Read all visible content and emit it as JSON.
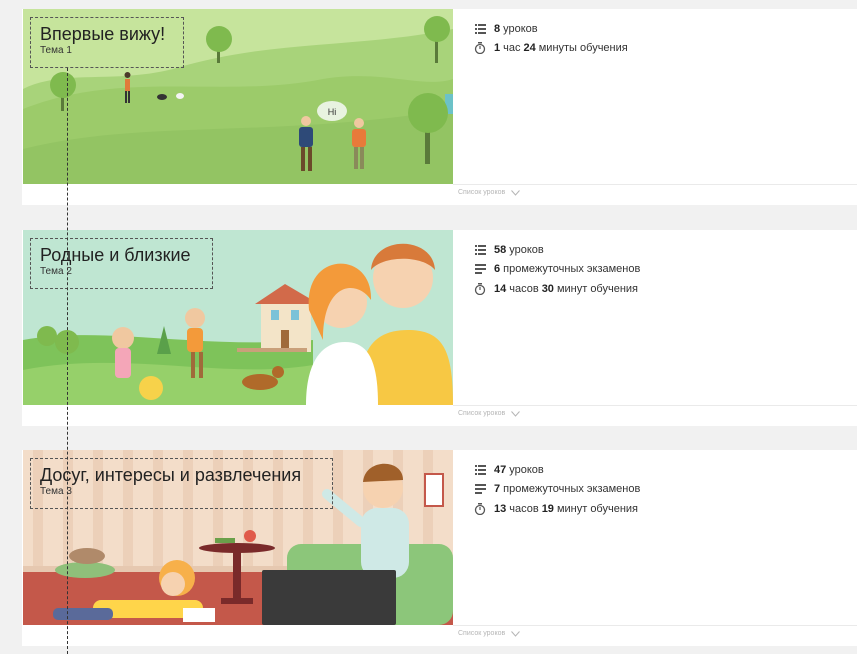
{
  "topics": [
    {
      "title": "Впервые вижу!",
      "subtitle": "Тема 1",
      "stats": [
        {
          "icon": "list-icon",
          "parts": [
            {
              "b": "8"
            },
            {
              "t": "уроков"
            }
          ]
        },
        {
          "icon": "timer-icon",
          "parts": [
            {
              "b": "1"
            },
            {
              "t": "час"
            },
            {
              "b": "24"
            },
            {
              "t": "минуты обучения"
            }
          ]
        }
      ],
      "speech": "Hi",
      "footer": "Список уроков"
    },
    {
      "title": "Родные и близкие",
      "subtitle": "Тема 2",
      "stats": [
        {
          "icon": "list-icon",
          "parts": [
            {
              "b": "58"
            },
            {
              "t": "уроков"
            }
          ]
        },
        {
          "icon": "exams-icon",
          "parts": [
            {
              "b": "6"
            },
            {
              "t": "промежуточных экзаменов"
            }
          ]
        },
        {
          "icon": "timer-icon",
          "parts": [
            {
              "b": "14"
            },
            {
              "t": "часов"
            },
            {
              "b": "30"
            },
            {
              "t": "минут обучения"
            }
          ]
        }
      ],
      "footer": "Список уроков"
    },
    {
      "title": "Досуг, интересы и развлечения",
      "subtitle": "Тема 3",
      "stats": [
        {
          "icon": "list-icon",
          "parts": [
            {
              "b": "47"
            },
            {
              "t": "уроков"
            }
          ]
        },
        {
          "icon": "exams-icon",
          "parts": [
            {
              "b": "7"
            },
            {
              "t": "промежуточных экзаменов"
            }
          ]
        },
        {
          "icon": "timer-icon",
          "parts": [
            {
              "b": "13"
            },
            {
              "t": "часов"
            },
            {
              "b": "19"
            },
            {
              "t": "минут обучения"
            }
          ]
        }
      ],
      "footer": "Список уроков"
    }
  ],
  "colors": {
    "icon": "#555555",
    "footer_text": "#b5b5b5"
  }
}
